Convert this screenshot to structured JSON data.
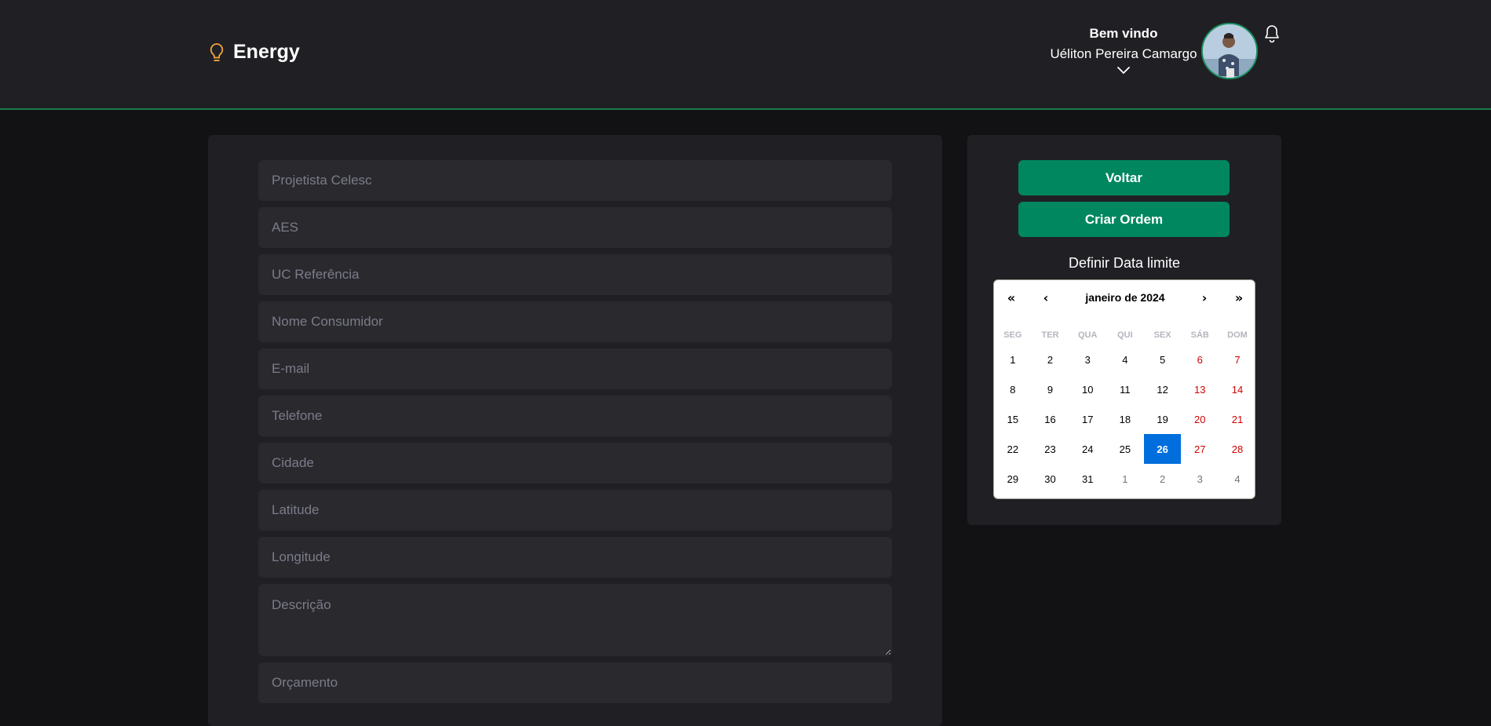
{
  "header": {
    "brand_name": "Energy",
    "welcome": "Bem vindo",
    "user_name": "Uéliton Pereira Camargo"
  },
  "form": {
    "fields": [
      {
        "placeholder": "Projetista Celesc",
        "value": ""
      },
      {
        "placeholder": "AES",
        "value": ""
      },
      {
        "placeholder": "UC Referência",
        "value": ""
      },
      {
        "placeholder": "Nome Consumidor",
        "value": ""
      },
      {
        "placeholder": "E-mail",
        "value": ""
      },
      {
        "placeholder": "Telefone",
        "value": ""
      },
      {
        "placeholder": "Cidade",
        "value": ""
      },
      {
        "placeholder": "Latitude",
        "value": ""
      },
      {
        "placeholder": "Longitude",
        "value": ""
      }
    ],
    "description": {
      "placeholder": "Descrição",
      "value": ""
    },
    "budget": {
      "placeholder": "Orçamento",
      "value": ""
    }
  },
  "actions": {
    "back_label": "Voltar",
    "create_label": "Criar Ordem"
  },
  "calendar": {
    "title": "Definir Data limite",
    "prev2": "«",
    "prev": "‹",
    "next": "›",
    "next2": "»",
    "month_label": "janeiro de 2024",
    "weekdays": [
      "SEG",
      "TER",
      "QUA",
      "QUI",
      "SEX",
      "SÁB",
      "DOM"
    ],
    "weeks": [
      [
        "1",
        "2",
        "3",
        "4",
        "5",
        "6",
        "7"
      ],
      [
        "8",
        "9",
        "10",
        "11",
        "12",
        "13",
        "14"
      ],
      [
        "15",
        "16",
        "17",
        "18",
        "19",
        "20",
        "21"
      ],
      [
        "22",
        "23",
        "24",
        "25",
        "26",
        "27",
        "28"
      ],
      [
        "29",
        "30",
        "31",
        "1",
        "2",
        "3",
        "4"
      ]
    ],
    "selected_day": "26",
    "colors": {
      "selected": "#006edc",
      "weekend": "#d10000",
      "neighbor": "#757575"
    }
  },
  "icons": [
    "lightbulb-icon",
    "chevron-down-icon",
    "bell-icon"
  ],
  "colors": {
    "accent": "#00875f",
    "accent_line": "#1a7a4f",
    "panel": "#202024",
    "input": "#29292e",
    "background": "#121214"
  }
}
